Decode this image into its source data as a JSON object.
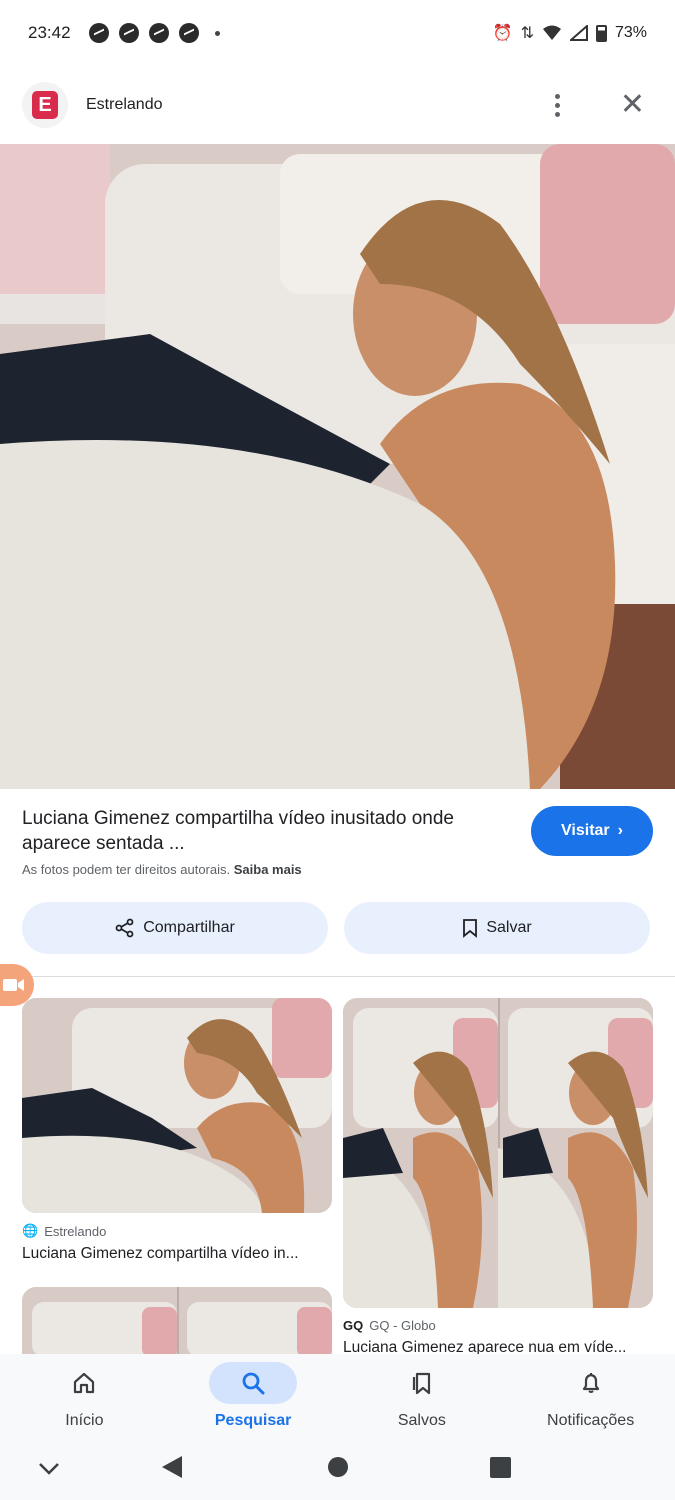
{
  "status_bar": {
    "time": "23:42",
    "notification_icons": [
      "messenger-icon",
      "messenger-icon",
      "messenger-icon",
      "messenger-icon"
    ],
    "battery": "73%"
  },
  "header": {
    "source_name": "Estrelando",
    "favicon_letter": "E"
  },
  "result": {
    "title": "Luciana Gimenez compartilha vídeo inusitado onde aparece sentada ...",
    "visit_label": "Visitar",
    "rights_text": "As fotos podem ter direitos autorais.",
    "rights_link": "Saiba mais",
    "share_label": "Compartilhar",
    "save_label": "Salvar"
  },
  "related": [
    {
      "source": "Estrelando",
      "title": "Luciana Gimenez compartilha vídeo in..."
    },
    {
      "source": "GQ - Globo",
      "title": "Luciana Gimenez aparece nua em víde..."
    }
  ],
  "bottom_nav": [
    {
      "label": "Início",
      "icon": "home-icon"
    },
    {
      "label": "Pesquisar",
      "icon": "search-icon",
      "active": true
    },
    {
      "label": "Salvos",
      "icon": "bookmarks-icon"
    },
    {
      "label": "Notificações",
      "icon": "bell-icon"
    }
  ],
  "colors": {
    "accent": "#1a73e8",
    "chip_bg": "#e8f0fe",
    "favicon": "#d92b4b"
  }
}
